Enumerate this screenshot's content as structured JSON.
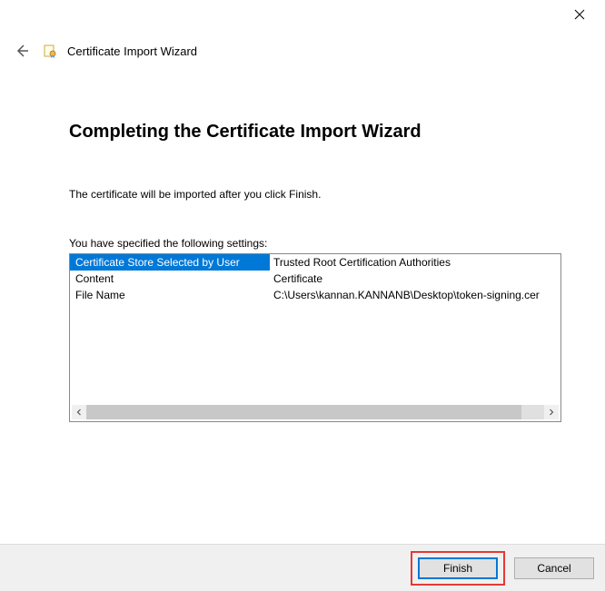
{
  "window": {
    "title": "Certificate Import Wizard"
  },
  "heading": "Completing the Certificate Import Wizard",
  "instruction": "The certificate will be imported after you click Finish.",
  "settings_label": "You have specified the following settings:",
  "settings": [
    {
      "key": "Certificate Store Selected by User",
      "value": "Trusted Root Certification Authorities",
      "selected": true
    },
    {
      "key": "Content",
      "value": "Certificate",
      "selected": false
    },
    {
      "key": "File Name",
      "value": "C:\\Users\\kannan.KANNANB\\Desktop\\token-signing.cer",
      "selected": false
    }
  ],
  "buttons": {
    "finish": "Finish",
    "cancel": "Cancel"
  }
}
